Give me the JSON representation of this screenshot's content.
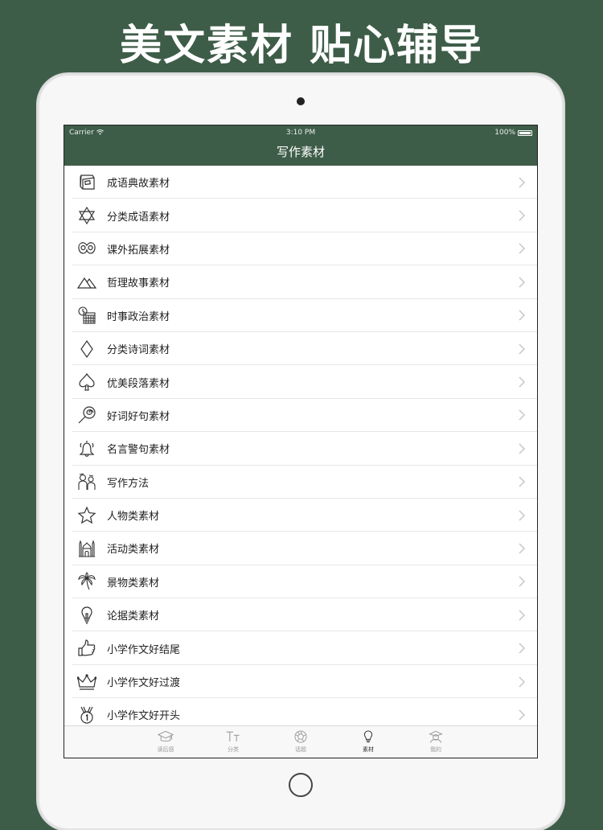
{
  "headline": "美文素材 贴心辅导",
  "status_bar": {
    "carrier": "Carrier",
    "time": "3:10 PM",
    "battery": "100%"
  },
  "nav": {
    "title": "写作素材"
  },
  "list_items": [
    {
      "label": "成语典故素材",
      "icon": "book-icon"
    },
    {
      "label": "分类成语素材",
      "icon": "star-of-david-icon"
    },
    {
      "label": "课外拓展素材",
      "icon": "pretzel-icon"
    },
    {
      "label": "哲理故事素材",
      "icon": "mountains-icon"
    },
    {
      "label": "时事政治素材",
      "icon": "calendar-clock-icon"
    },
    {
      "label": "分类诗词素材",
      "icon": "diamond-icon"
    },
    {
      "label": "优美段落素材",
      "icon": "spade-icon"
    },
    {
      "label": "好词好句素材",
      "icon": "lollipop-icon"
    },
    {
      "label": "名言警句素材",
      "icon": "bell-icon"
    },
    {
      "label": "写作方法",
      "icon": "people-icon"
    },
    {
      "label": "人物类素材",
      "icon": "star-icon"
    },
    {
      "label": "活动类素材",
      "icon": "mosque-icon"
    },
    {
      "label": "景物类素材",
      "icon": "palm-tree-icon"
    },
    {
      "label": "论据类素材",
      "icon": "lightbulb-icon"
    },
    {
      "label": "小学作文好结尾",
      "icon": "thumbs-up-icon"
    },
    {
      "label": "小学作文好过渡",
      "icon": "crown-icon"
    },
    {
      "label": "小学作文好开头",
      "icon": "medal-icon"
    }
  ],
  "tabs": [
    {
      "label": "读后感",
      "icon": "graduation-cap-icon",
      "active": false
    },
    {
      "label": "分类",
      "icon": "text-size-icon",
      "active": false
    },
    {
      "label": "话题",
      "icon": "aperture-icon",
      "active": false
    },
    {
      "label": "素材",
      "icon": "lightbulb-icon",
      "active": true
    },
    {
      "label": "我的",
      "icon": "user-icon",
      "active": false
    }
  ],
  "colors": {
    "background": "#3e5d48",
    "nav_bar": "#3e5d48",
    "chevron": "#c7c7cc"
  }
}
